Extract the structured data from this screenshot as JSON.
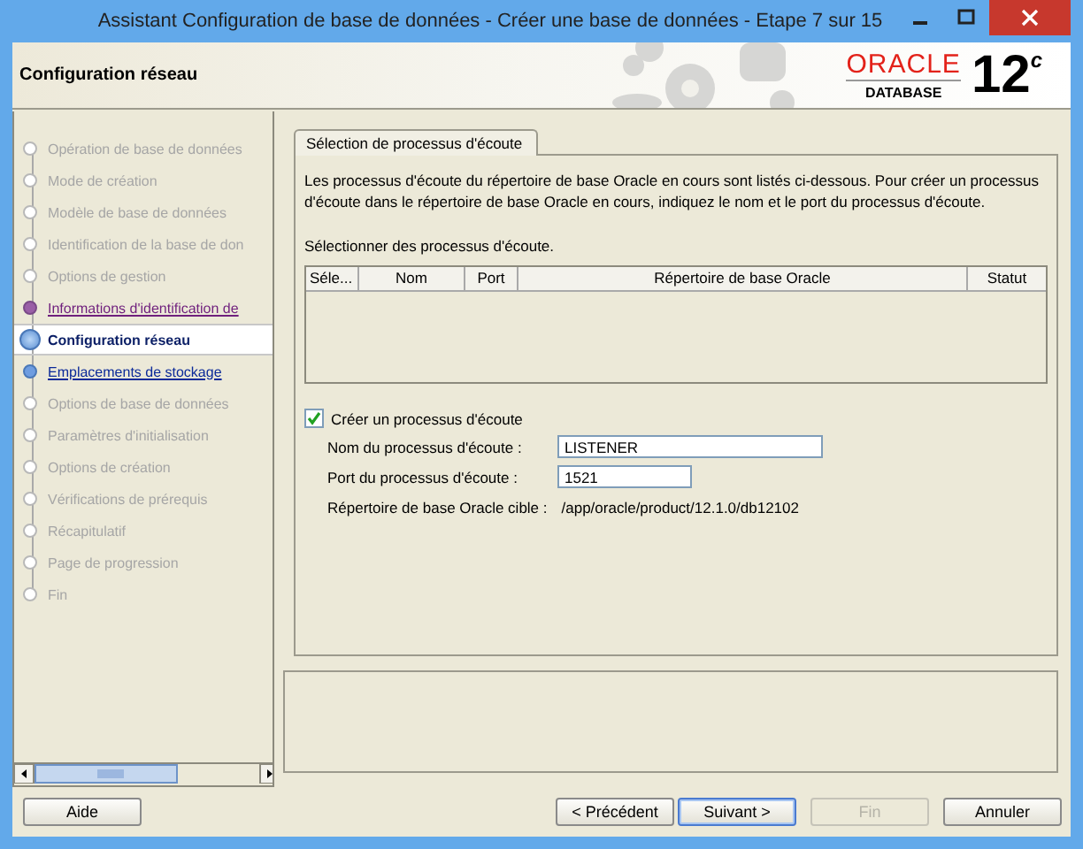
{
  "window": {
    "title": "Assistant Configuration de base de données - Créer une base de données - Etape 7 sur 15"
  },
  "header": {
    "title": "Configuration réseau",
    "logo": {
      "brand": "ORACLE",
      "product": "DATABASE",
      "version": "12",
      "suffix": "c"
    }
  },
  "steps": [
    {
      "label": "Opération de base de données",
      "kind": "pending"
    },
    {
      "label": "Mode de création",
      "kind": "pending"
    },
    {
      "label": "Modèle de base de données",
      "kind": "pending"
    },
    {
      "label": "Identification de la base de don",
      "kind": "pending"
    },
    {
      "label": "Options de gestion",
      "kind": "pending"
    },
    {
      "label": "Informations d'identification de",
      "kind": "visited"
    },
    {
      "label": "Configuration réseau",
      "kind": "current"
    },
    {
      "label": "Emplacements de stockage",
      "kind": "next"
    },
    {
      "label": "Options de base de données",
      "kind": "pending"
    },
    {
      "label": "Paramètres d'initialisation",
      "kind": "pending"
    },
    {
      "label": "Options de création",
      "kind": "pending"
    },
    {
      "label": "Vérifications de prérequis",
      "kind": "pending"
    },
    {
      "label": "Récapitulatif",
      "kind": "pending"
    },
    {
      "label": "Page de progression",
      "kind": "pending"
    },
    {
      "label": "Fin",
      "kind": "pending"
    }
  ],
  "tabs": [
    {
      "label": "Sélection de processus d'écoute",
      "selected": true
    }
  ],
  "description": "Les processus d'écoute du répertoire de base Oracle en cours sont listés ci-dessous. Pour créer un processus d'écoute dans le répertoire de base Oracle en cours, indiquez le nom et le port du processus d'écoute.",
  "table": {
    "caption": "Sélectionner des processus d'écoute.",
    "columns": [
      "Séle...",
      "Nom",
      "Port",
      "Répertoire de base Oracle",
      "Statut"
    ]
  },
  "create_listener": {
    "label": "Créer un processus d'écoute",
    "checked": true
  },
  "fields": [
    {
      "label": "Nom du processus d'écoute :",
      "value": "LISTENER"
    },
    {
      "label": "Port du processus d'écoute :",
      "value": "1521"
    }
  ],
  "target_home": {
    "label": "Répertoire de base Oracle cible :",
    "value": "/app/oracle/product/12.1.0/db12102"
  },
  "buttons": [
    {
      "label": "Aide",
      "disabled": false,
      "default": false
    },
    {
      "label": "< Précédent",
      "disabled": false,
      "default": false
    },
    {
      "label": "Suivant >",
      "disabled": false,
      "default": true
    },
    {
      "label": "Fin",
      "disabled": true,
      "default": false
    },
    {
      "label": "Annuler",
      "disabled": false,
      "default": false
    }
  ]
}
